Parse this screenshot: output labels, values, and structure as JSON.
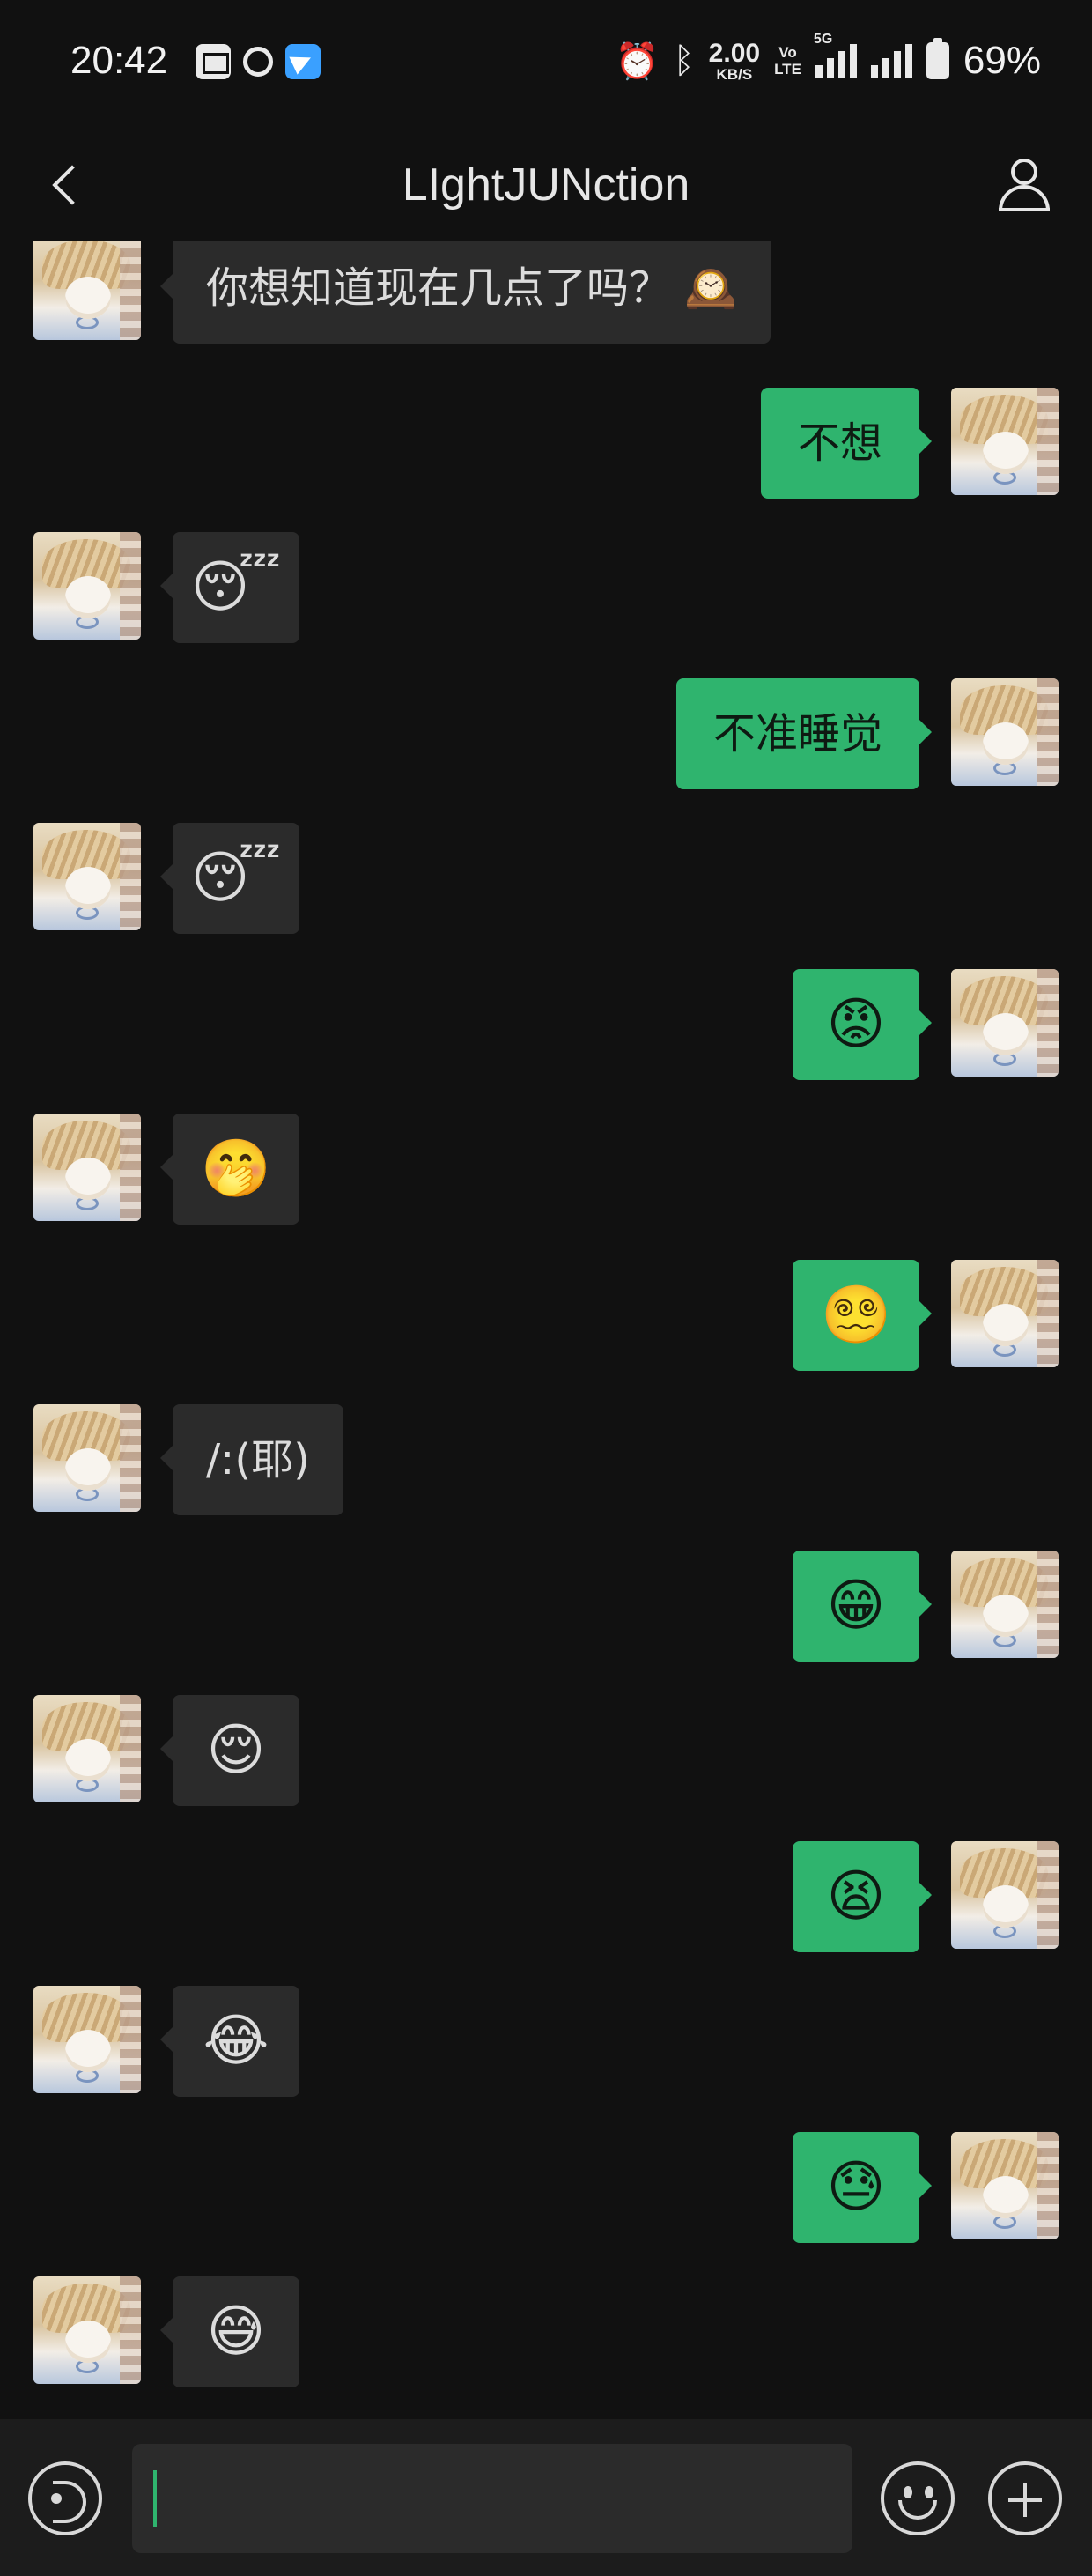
{
  "status_bar": {
    "time": "20:42",
    "net_speed_value": "2.00",
    "net_speed_unit": "KB/S",
    "volte_line1": "Vo",
    "volte_line2": "LTE",
    "signal_label": "5G",
    "battery_percent": "69%",
    "icons": [
      "mail-icon",
      "sync-icon",
      "telegram-icon",
      "alarm-icon",
      "bluetooth-icon",
      "signal-icon",
      "battery-icon"
    ]
  },
  "header": {
    "title": "LIghtJUNction",
    "back_icon": "chevron-left-icon",
    "profile_icon": "person-icon"
  },
  "messages": [
    {
      "side": "left",
      "type": "text",
      "text": "你想知道现在几点了吗？ 🕰️"
    },
    {
      "side": "right",
      "type": "text",
      "text": "不想"
    },
    {
      "side": "left",
      "type": "emoji",
      "text": "😴"
    },
    {
      "side": "right",
      "type": "text",
      "text": "不准睡觉"
    },
    {
      "side": "left",
      "type": "emoji",
      "text": "😴"
    },
    {
      "side": "right",
      "type": "emoji",
      "text": "😡"
    },
    {
      "side": "left",
      "type": "emoji",
      "text": "🤭"
    },
    {
      "side": "right",
      "type": "emoji",
      "text": "😵‍💫"
    },
    {
      "side": "left",
      "type": "text",
      "text": "/:(耶)"
    },
    {
      "side": "right",
      "type": "emoji",
      "text": "😁"
    },
    {
      "side": "left",
      "type": "emoji",
      "text": "😌"
    },
    {
      "side": "right",
      "type": "emoji",
      "text": "😫"
    },
    {
      "side": "left",
      "type": "emoji",
      "text": "😂"
    },
    {
      "side": "right",
      "type": "emoji",
      "text": "😓"
    },
    {
      "side": "left",
      "type": "emoji",
      "text": "😅"
    }
  ],
  "input_bar": {
    "voice_icon": "voice-icon",
    "emoji_icon": "emoji-icon",
    "plus_icon": "plus-icon",
    "text_value": ""
  },
  "colors": {
    "background": "#111111",
    "sent_bubble": "#2fb46e",
    "received_bubble": "#2b2b2b",
    "caret": "#2fb46e"
  }
}
